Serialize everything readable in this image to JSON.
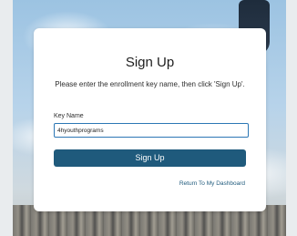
{
  "form": {
    "title": "Sign Up",
    "instructions": "Please enter the enrollment key name, then click 'Sign Up'.",
    "key_label": "Key Name",
    "key_value": "4hyouthprograms",
    "submit_label": "Sign Up",
    "return_link": "Return To My Dashboard"
  },
  "colors": {
    "button": "#1f5a7c",
    "link": "#1f5a7c",
    "input_border": "#2c77b5"
  }
}
